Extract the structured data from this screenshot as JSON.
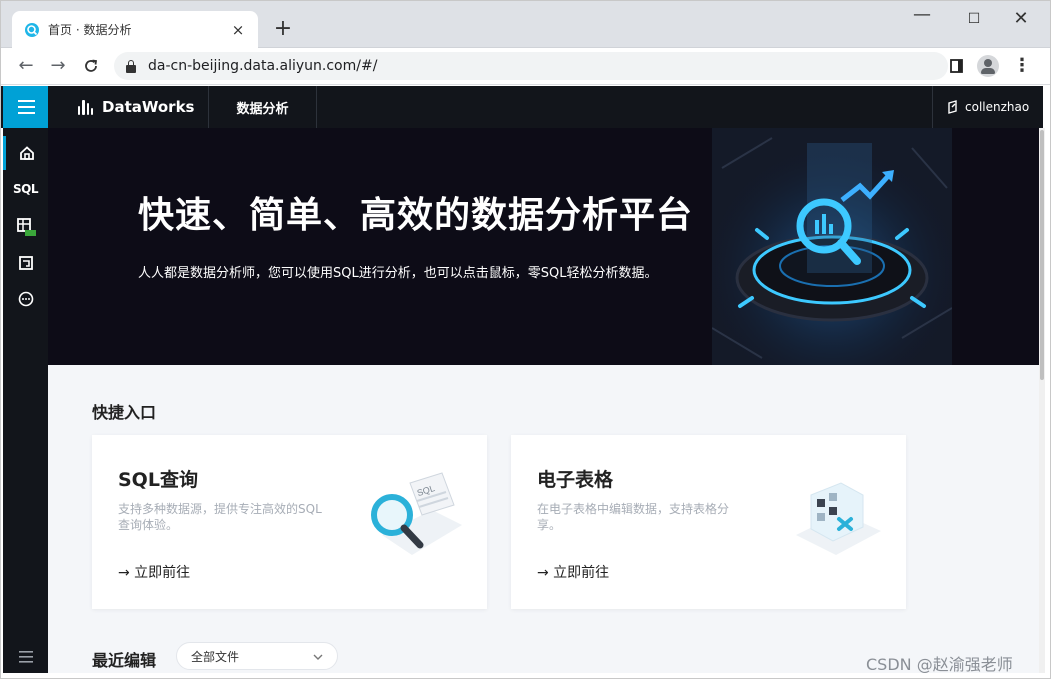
{
  "browser": {
    "tab_title": "首页 · 数据分析",
    "tab_close": "×",
    "new_tab": "+",
    "url": "da-cn-beijing.data.aliyun.com/#/",
    "window_controls": {
      "minimize": "—",
      "maximize": "☐",
      "close": "✕"
    },
    "nav": {
      "back": "←",
      "forward": "→",
      "reload": "C"
    },
    "menu_dots": "⋮"
  },
  "app": {
    "brand": "DataWorks",
    "top_menu_item": "数据分析",
    "user_name": "collenzhao",
    "sidebar": {
      "items": [
        {
          "icon": "home-icon",
          "label": ""
        },
        {
          "icon": "sql-icon",
          "label": "SQL"
        },
        {
          "icon": "spreadsheet-beta-icon",
          "label": ""
        },
        {
          "icon": "box-icon",
          "label": ""
        },
        {
          "icon": "more-icon",
          "label": ""
        }
      ]
    }
  },
  "hero": {
    "title": "快速、简单、高效的数据分析平台",
    "subtitle": "人人都是数据分析师，您可以使用SQL进行分析，也可以点击鼠标，零SQL轻松分析数据。"
  },
  "quick_entry": {
    "title": "快捷入口",
    "cards": [
      {
        "title": "SQL查询",
        "desc": "支持多种数据源，提供专注高效的SQL查询体验。",
        "link": "→ 立即前往",
        "icon": "sql-magnifier-icon"
      },
      {
        "title": "电子表格",
        "desc": "在电子表格中编辑数据，支持表格分享。",
        "link": "→ 立即前往",
        "icon": "spreadsheet-cube-icon"
      }
    ]
  },
  "recent": {
    "title": "最近编辑",
    "filter_value": "全部文件"
  },
  "watermark": "CSDN @赵渝强老师",
  "colors": {
    "accent": "#00a1d6",
    "dark_bg": "#12151b",
    "hero_bg": "#0d0c17",
    "content_bg": "#f4f6f9"
  }
}
